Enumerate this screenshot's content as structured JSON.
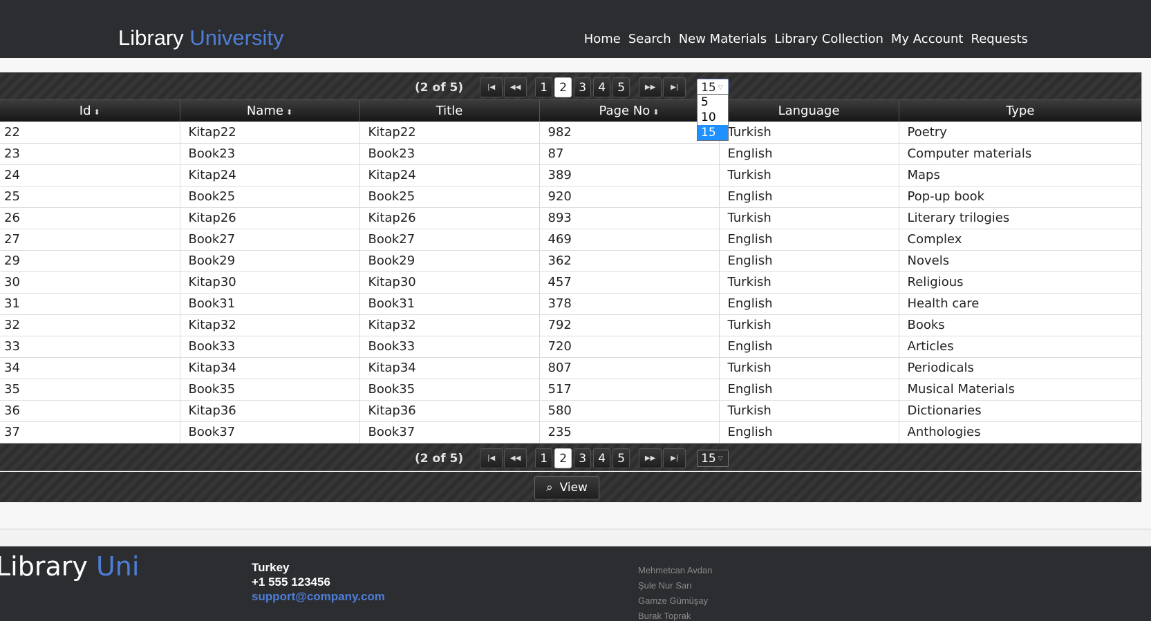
{
  "header": {
    "brand_main": "Library",
    "brand_accent": "University",
    "nav": [
      "Home",
      "Search",
      "New Materials",
      "Library Collection",
      "My Account",
      "Requests"
    ]
  },
  "pager": {
    "report": "(2 of 5)",
    "pages": [
      "1",
      "2",
      "3",
      "4",
      "5"
    ],
    "current_page": "2",
    "rows_per_page": "15",
    "rows_options": [
      "5",
      "10",
      "15"
    ]
  },
  "table": {
    "columns": [
      "Id",
      "Name",
      "Title",
      "Page No",
      "Language",
      "Type"
    ],
    "rows": [
      [
        "22",
        "Kitap22",
        "Kitap22",
        "982",
        "Turkish",
        "Poetry"
      ],
      [
        "23",
        "Book23",
        "Book23",
        "87",
        "English",
        "Computer materials"
      ],
      [
        "24",
        "Kitap24",
        "Kitap24",
        "389",
        "Turkish",
        "Maps"
      ],
      [
        "25",
        "Book25",
        "Book25",
        "920",
        "English",
        "Pop-up book"
      ],
      [
        "26",
        "Kitap26",
        "Kitap26",
        "893",
        "Turkish",
        "Literary trilogies"
      ],
      [
        "27",
        "Book27",
        "Book27",
        "469",
        "English",
        "Complex"
      ],
      [
        "29",
        "Book29",
        "Book29",
        "362",
        "English",
        "Novels"
      ],
      [
        "30",
        "Kitap30",
        "Kitap30",
        "457",
        "Turkish",
        "Religious"
      ],
      [
        "31",
        "Book31",
        "Book31",
        "378",
        "English",
        "Health care"
      ],
      [
        "32",
        "Kitap32",
        "Kitap32",
        "792",
        "Turkish",
        "Books"
      ],
      [
        "33",
        "Book33",
        "Book33",
        "720",
        "English",
        "Articles"
      ],
      [
        "34",
        "Kitap34",
        "Kitap34",
        "807",
        "Turkish",
        "Periodicals"
      ],
      [
        "35",
        "Book35",
        "Book35",
        "517",
        "English",
        "Musical Materials"
      ],
      [
        "36",
        "Kitap36",
        "Kitap36",
        "580",
        "Turkish",
        "Dictionaries"
      ],
      [
        "37",
        "Book37",
        "Book37",
        "235",
        "English",
        "Anthologies"
      ]
    ]
  },
  "actions": {
    "view_label": "View"
  },
  "footer": {
    "logo_main": "Library",
    "logo_accent": "Uni",
    "country": "Turkey",
    "phone": "+1 555 123456",
    "email": "support@company.com",
    "names": [
      "Mehmetcan Avdan",
      "Şule Nur Sarı",
      "Gamze Gümüşay",
      "Burak Toprak"
    ]
  },
  "colors": {
    "header_bg": "#2b2d31",
    "accent": "#4f7ed6",
    "selected_option": "#1e90ff"
  }
}
